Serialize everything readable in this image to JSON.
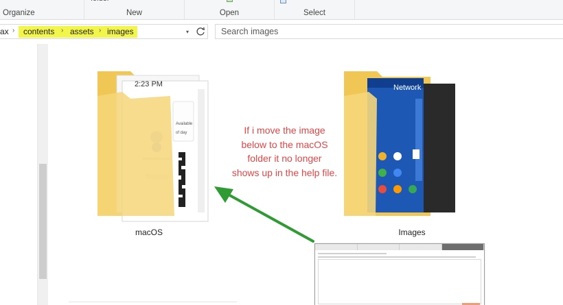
{
  "ribbon": {
    "cut_label": "folder",
    "groups": [
      {
        "label": "Organize"
      },
      {
        "label": "New"
      },
      {
        "label": "Open"
      },
      {
        "label": "Select"
      }
    ]
  },
  "address": {
    "crumbs": [
      "ax",
      "contents",
      "assets",
      "images"
    ]
  },
  "search": {
    "placeholder": "Search images"
  },
  "folders": [
    {
      "name": "macOS",
      "preview_time": "2:23 PM",
      "preview_snippets": [
        "Available",
        "of day"
      ]
    },
    {
      "name": "Images",
      "preview_title": "Network"
    }
  ],
  "annotation": {
    "lines": [
      "If i move the image",
      "below to the macOS",
      "folder it no longer",
      "shows up in the help file."
    ],
    "color": "#e24545"
  },
  "arrow_color": "#2e9b33",
  "highlight_color": "#f3f64a"
}
